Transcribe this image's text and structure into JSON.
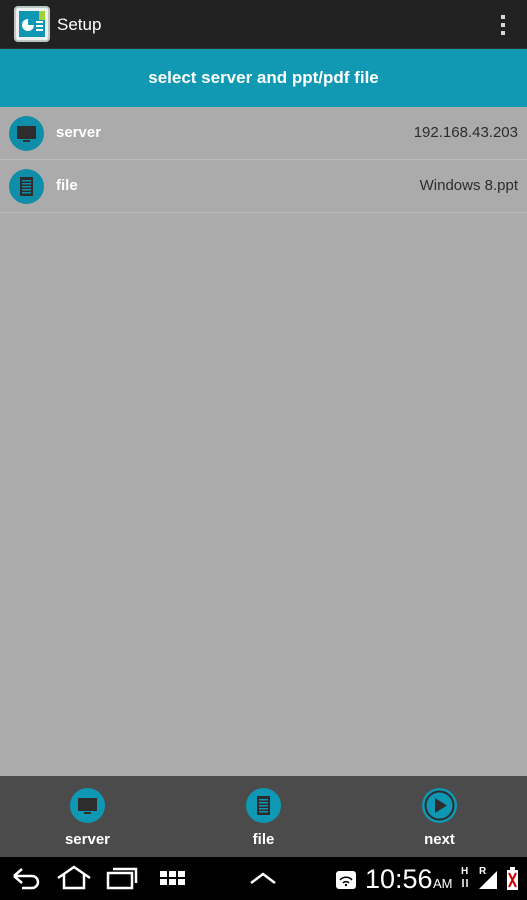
{
  "action_bar": {
    "title": "Setup",
    "app_icon": "presentation-app-icon",
    "overflow_icon": "overflow-menu-icon"
  },
  "header": {
    "text": "select server and ppt/pdf file"
  },
  "rows": [
    {
      "icon": "monitor-icon",
      "label": "server",
      "value": "192.168.43.203"
    },
    {
      "icon": "document-icon",
      "label": "file",
      "value": "Windows 8.ppt"
    }
  ],
  "bottom_tabs": [
    {
      "icon": "monitor-icon",
      "label": "server"
    },
    {
      "icon": "document-icon",
      "label": "file"
    },
    {
      "icon": "play-icon",
      "label": "next"
    }
  ],
  "system_bar": {
    "time": "10:56",
    "ampm": "AM",
    "icons": [
      "back-icon",
      "home-icon",
      "recent-apps-icon",
      "apps-grid-icon",
      "up-chevron-icon",
      "wifi-icon",
      "signal-icon",
      "battery-icon"
    ]
  },
  "colors": {
    "accent": "#1198b3",
    "background": "#ababab",
    "action_bar": "#222222",
    "bottom_bar": "#4b4b4b"
  }
}
